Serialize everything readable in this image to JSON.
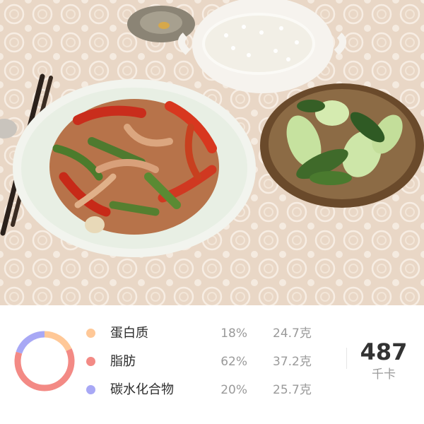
{
  "photo": {
    "description_icon": "food-photo-icon"
  },
  "nutrition": {
    "items": [
      {
        "label": "蛋白质",
        "percent": "18%",
        "grams": "24.7克",
        "color": "#ffc897",
        "share": 0.18
      },
      {
        "label": "脂肪",
        "percent": "62%",
        "grams": "37.2克",
        "color": "#f38a85",
        "share": 0.62
      },
      {
        "label": "碳水化合物",
        "percent": "20%",
        "grams": "25.7克",
        "color": "#a8a8f5",
        "share": 0.2
      }
    ],
    "total_value": "487",
    "total_unit": "千卡"
  }
}
